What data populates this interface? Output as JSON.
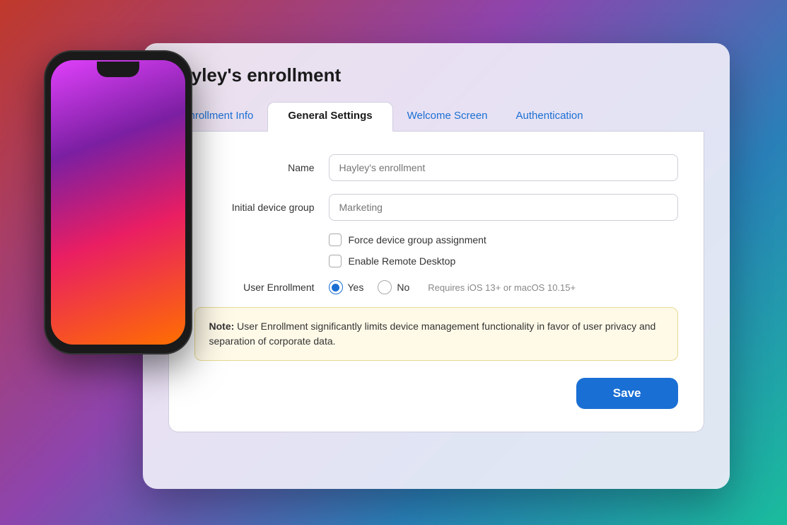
{
  "dialog": {
    "title": "Hayley's enrollment",
    "tabs": [
      {
        "id": "enrollment-info",
        "label": "Enrollment Info",
        "active": false
      },
      {
        "id": "general-settings",
        "label": "General Settings",
        "active": true
      },
      {
        "id": "welcome-screen",
        "label": "Welcome Screen",
        "active": false
      },
      {
        "id": "authentication",
        "label": "Authentication",
        "active": false
      }
    ],
    "form": {
      "name_label": "Name",
      "name_placeholder": "Hayley's enrollment",
      "device_group_label": "Initial device group",
      "device_group_placeholder": "Marketing",
      "force_device_group_label": "Force device group assignment",
      "enable_remote_label": "Enable Remote Desktop",
      "user_enrollment_label": "User Enrollment",
      "radio_yes": "Yes",
      "radio_no": "No",
      "radio_hint": "Requires iOS 13+ or macOS 10.15+",
      "note_bold": "Note:",
      "note_text": " User Enrollment significantly limits device management functionality in favor of user privacy and separation of corporate data.",
      "save_label": "Save"
    }
  }
}
